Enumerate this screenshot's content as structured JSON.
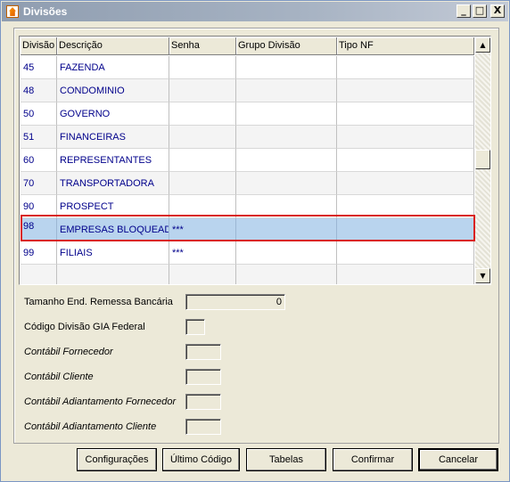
{
  "window": {
    "title": "Divisões",
    "minimize": "_",
    "maximize": "□",
    "close": "X"
  },
  "grid": {
    "columns": [
      "Divisão",
      "Descrição",
      "Senha",
      "Grupo Divisão",
      "Tipo NF"
    ],
    "rows": [
      {
        "divisao": "45",
        "descricao": "FAZENDA",
        "senha": "",
        "grupo": "",
        "tipo": ""
      },
      {
        "divisao": "48",
        "descricao": "CONDOMINIO",
        "senha": "",
        "grupo": "",
        "tipo": ""
      },
      {
        "divisao": "50",
        "descricao": "GOVERNO",
        "senha": "",
        "grupo": "",
        "tipo": ""
      },
      {
        "divisao": "51",
        "descricao": "FINANCEIRAS",
        "senha": "",
        "grupo": "",
        "tipo": ""
      },
      {
        "divisao": "60",
        "descricao": "REPRESENTANTES",
        "senha": "",
        "grupo": "",
        "tipo": ""
      },
      {
        "divisao": "70",
        "descricao": "TRANSPORTADORA",
        "senha": "",
        "grupo": "",
        "tipo": ""
      },
      {
        "divisao": "90",
        "descricao": "PROSPECT",
        "senha": "",
        "grupo": "",
        "tipo": ""
      },
      {
        "divisao": "98",
        "descricao": "EMPRESAS BLOQUEAD",
        "senha": "***",
        "grupo": "",
        "tipo": ""
      },
      {
        "divisao": "99",
        "descricao": "FILIAIS",
        "senha": "***",
        "grupo": "",
        "tipo": ""
      },
      {
        "divisao": "",
        "descricao": "",
        "senha": "",
        "grupo": "",
        "tipo": ""
      }
    ],
    "selected_row": 7,
    "scroll_up": "▲",
    "scroll_down": "▼"
  },
  "form": {
    "tamanho_label": "Tamanho End. Remessa Bancária",
    "tamanho_value": "0",
    "codigo_gia_label": "Código Divisão GIA Federal",
    "contabil_fornecedor_label": "Contábil Fornecedor",
    "contabil_cliente_label": "Contábil Cliente",
    "contabil_adiant_fornecedor_label": "Contábil Adiantamento Fornecedor",
    "contabil_adiant_cliente_label": "Contábil Adiantamento Cliente"
  },
  "buttons": {
    "configuracoes": "Configurações",
    "ultimo_codigo": "Último Código",
    "tabelas": "Tabelas",
    "confirmar": "Confirmar",
    "cancelar": "Cancelar"
  }
}
